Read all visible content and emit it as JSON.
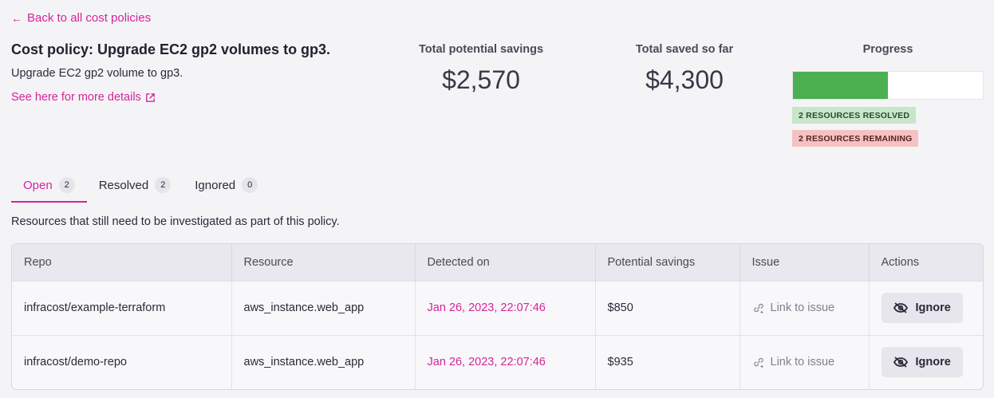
{
  "header": {
    "back_label": "Back to all cost policies",
    "policy_title": "Cost policy: Upgrade EC2 gp2 volumes to gp3.",
    "policy_description": "Upgrade EC2 gp2 volume to gp3.",
    "details_link_label": "See here for more details"
  },
  "stats": {
    "potential_label": "Total potential savings",
    "potential_value": "$2,570",
    "saved_label": "Total saved so far",
    "saved_value": "$4,300"
  },
  "progress": {
    "label": "Progress",
    "fraction_resolved": 0.5,
    "resolved_badge": "2 RESOURCES RESOLVED",
    "remaining_badge": "2 RESOURCES REMAINING",
    "fill_color": "#4caf50"
  },
  "tabs": [
    {
      "label": "Open",
      "count": "2",
      "active": true
    },
    {
      "label": "Resolved",
      "count": "2",
      "active": false
    },
    {
      "label": "Ignored",
      "count": "0",
      "active": false
    }
  ],
  "section_description": "Resources that still need to be investigated as part of this policy.",
  "table": {
    "headers": [
      "Repo",
      "Resource",
      "Detected on",
      "Potential savings",
      "Issue",
      "Actions"
    ],
    "rows": [
      {
        "repo": "infracost/example-terraform",
        "resource": "aws_instance.web_app",
        "detected_on": "Jan 26, 2023, 22:07:46",
        "savings": "$850",
        "issue_label": "Link to issue",
        "action_label": "Ignore"
      },
      {
        "repo": "infracost/demo-repo",
        "resource": "aws_instance.web_app",
        "detected_on": "Jan 26, 2023, 22:07:46",
        "savings": "$935",
        "issue_label": "Link to issue",
        "action_label": "Ignore"
      }
    ]
  },
  "icons": {
    "back": "arrow-left-icon",
    "external": "external-link-icon",
    "issue": "link-plus-icon",
    "ignore": "eye-off-icon"
  },
  "accent_color": "#d6239a"
}
